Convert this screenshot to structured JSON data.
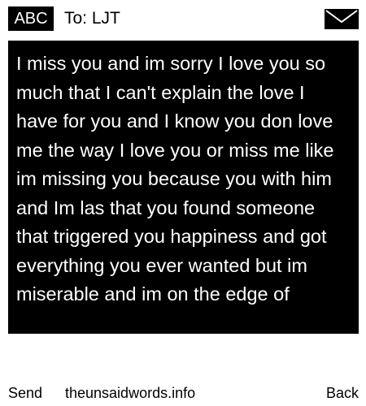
{
  "header": {
    "mode_label": "ABC",
    "recipient": "To: LJT",
    "icon": "envelope-icon"
  },
  "message": {
    "body": "I miss you and im sorry I love you so much that I can't explain the love I have for you and I know you don love me the way I love you or miss me like im missing you because you with him and Im las that you found someone that triggered you happiness and got everything you ever wanted but im miserable and im on the edge of"
  },
  "softkeys": {
    "left": "Send",
    "center": "theunsaidwords.info",
    "right": "Back"
  },
  "colors": {
    "background": "#ffffff",
    "message_background": "#000000",
    "message_text": "#ffffff"
  }
}
